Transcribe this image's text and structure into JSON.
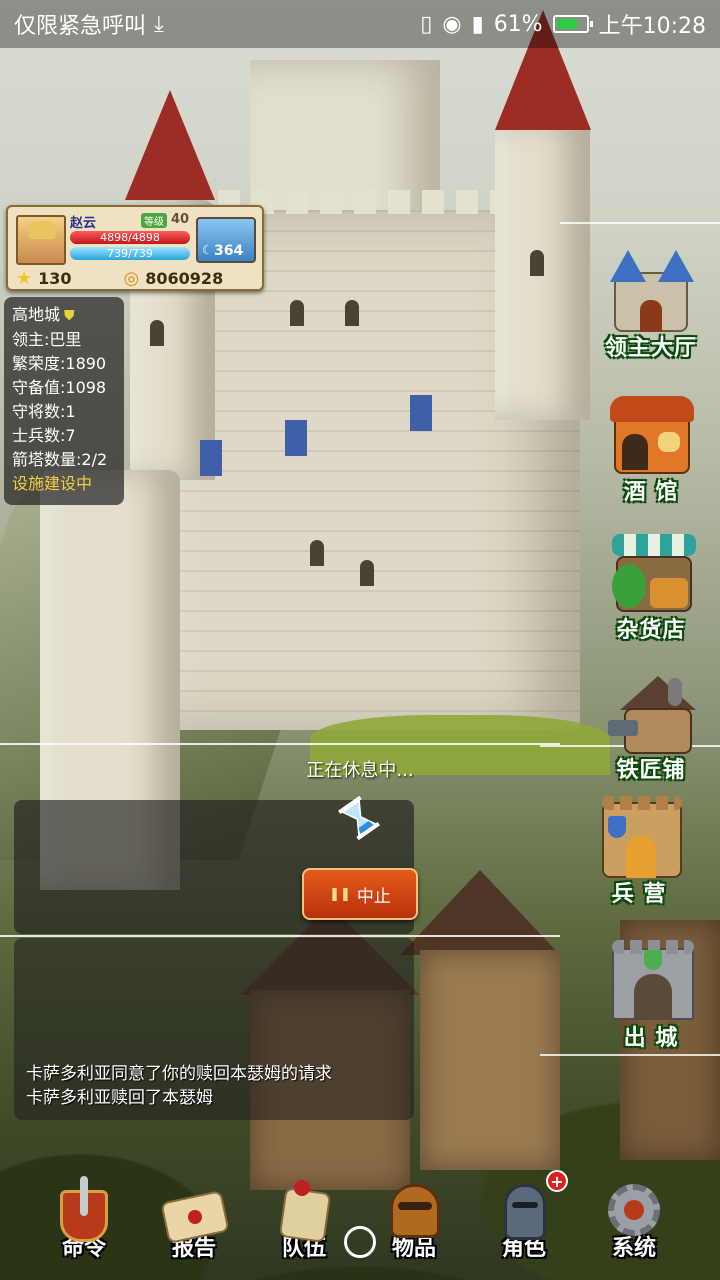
{
  "status_bar": {
    "carrier": "仅限紧急呼叫",
    "battery": "61%",
    "time": "上午10:28"
  },
  "player": {
    "name": "赵云",
    "level_tag": "等级",
    "level": "40",
    "hp": "4898/4898",
    "hp_fraction": 1.0,
    "mp": "739/739",
    "mp_fraction": 1.0,
    "stamina": "364",
    "stars": "130",
    "gold": "8060928"
  },
  "city": {
    "name": "高地城",
    "lord": "领主:巴里",
    "prosperity": "繁荣度:1890",
    "defense": "守备值:1098",
    "generals": "守将数:1",
    "soldiers": "士兵数:7",
    "towers": "箭塔数量:2/2",
    "building": "设施建设中"
  },
  "buildings": [
    {
      "label": "领主大厅",
      "icon": "lord-hall-icon"
    },
    {
      "label": "酒 馆",
      "icon": "tavern-icon"
    },
    {
      "label": "杂货店",
      "icon": "grocery-icon"
    },
    {
      "label": "铁匠铺",
      "icon": "blacksmith-icon"
    },
    {
      "label": "兵 营",
      "icon": "barracks-icon"
    },
    {
      "label": "出 城",
      "icon": "city-gate-icon"
    }
  ],
  "rest": {
    "title": "正在休息中...",
    "stop_label": "中止"
  },
  "log": [
    "卡萨多利亚同意了你的赎回本瑟姆的请求",
    "卡萨多利亚赎回了本瑟姆"
  ],
  "nav": [
    {
      "label": "命令",
      "icon": "command-icon"
    },
    {
      "label": "报告",
      "icon": "report-icon"
    },
    {
      "label": "队伍",
      "icon": "team-icon"
    },
    {
      "label": "物品",
      "icon": "items-icon"
    },
    {
      "label": "角色",
      "icon": "character-icon"
    },
    {
      "label": "系统",
      "icon": "system-icon"
    }
  ]
}
